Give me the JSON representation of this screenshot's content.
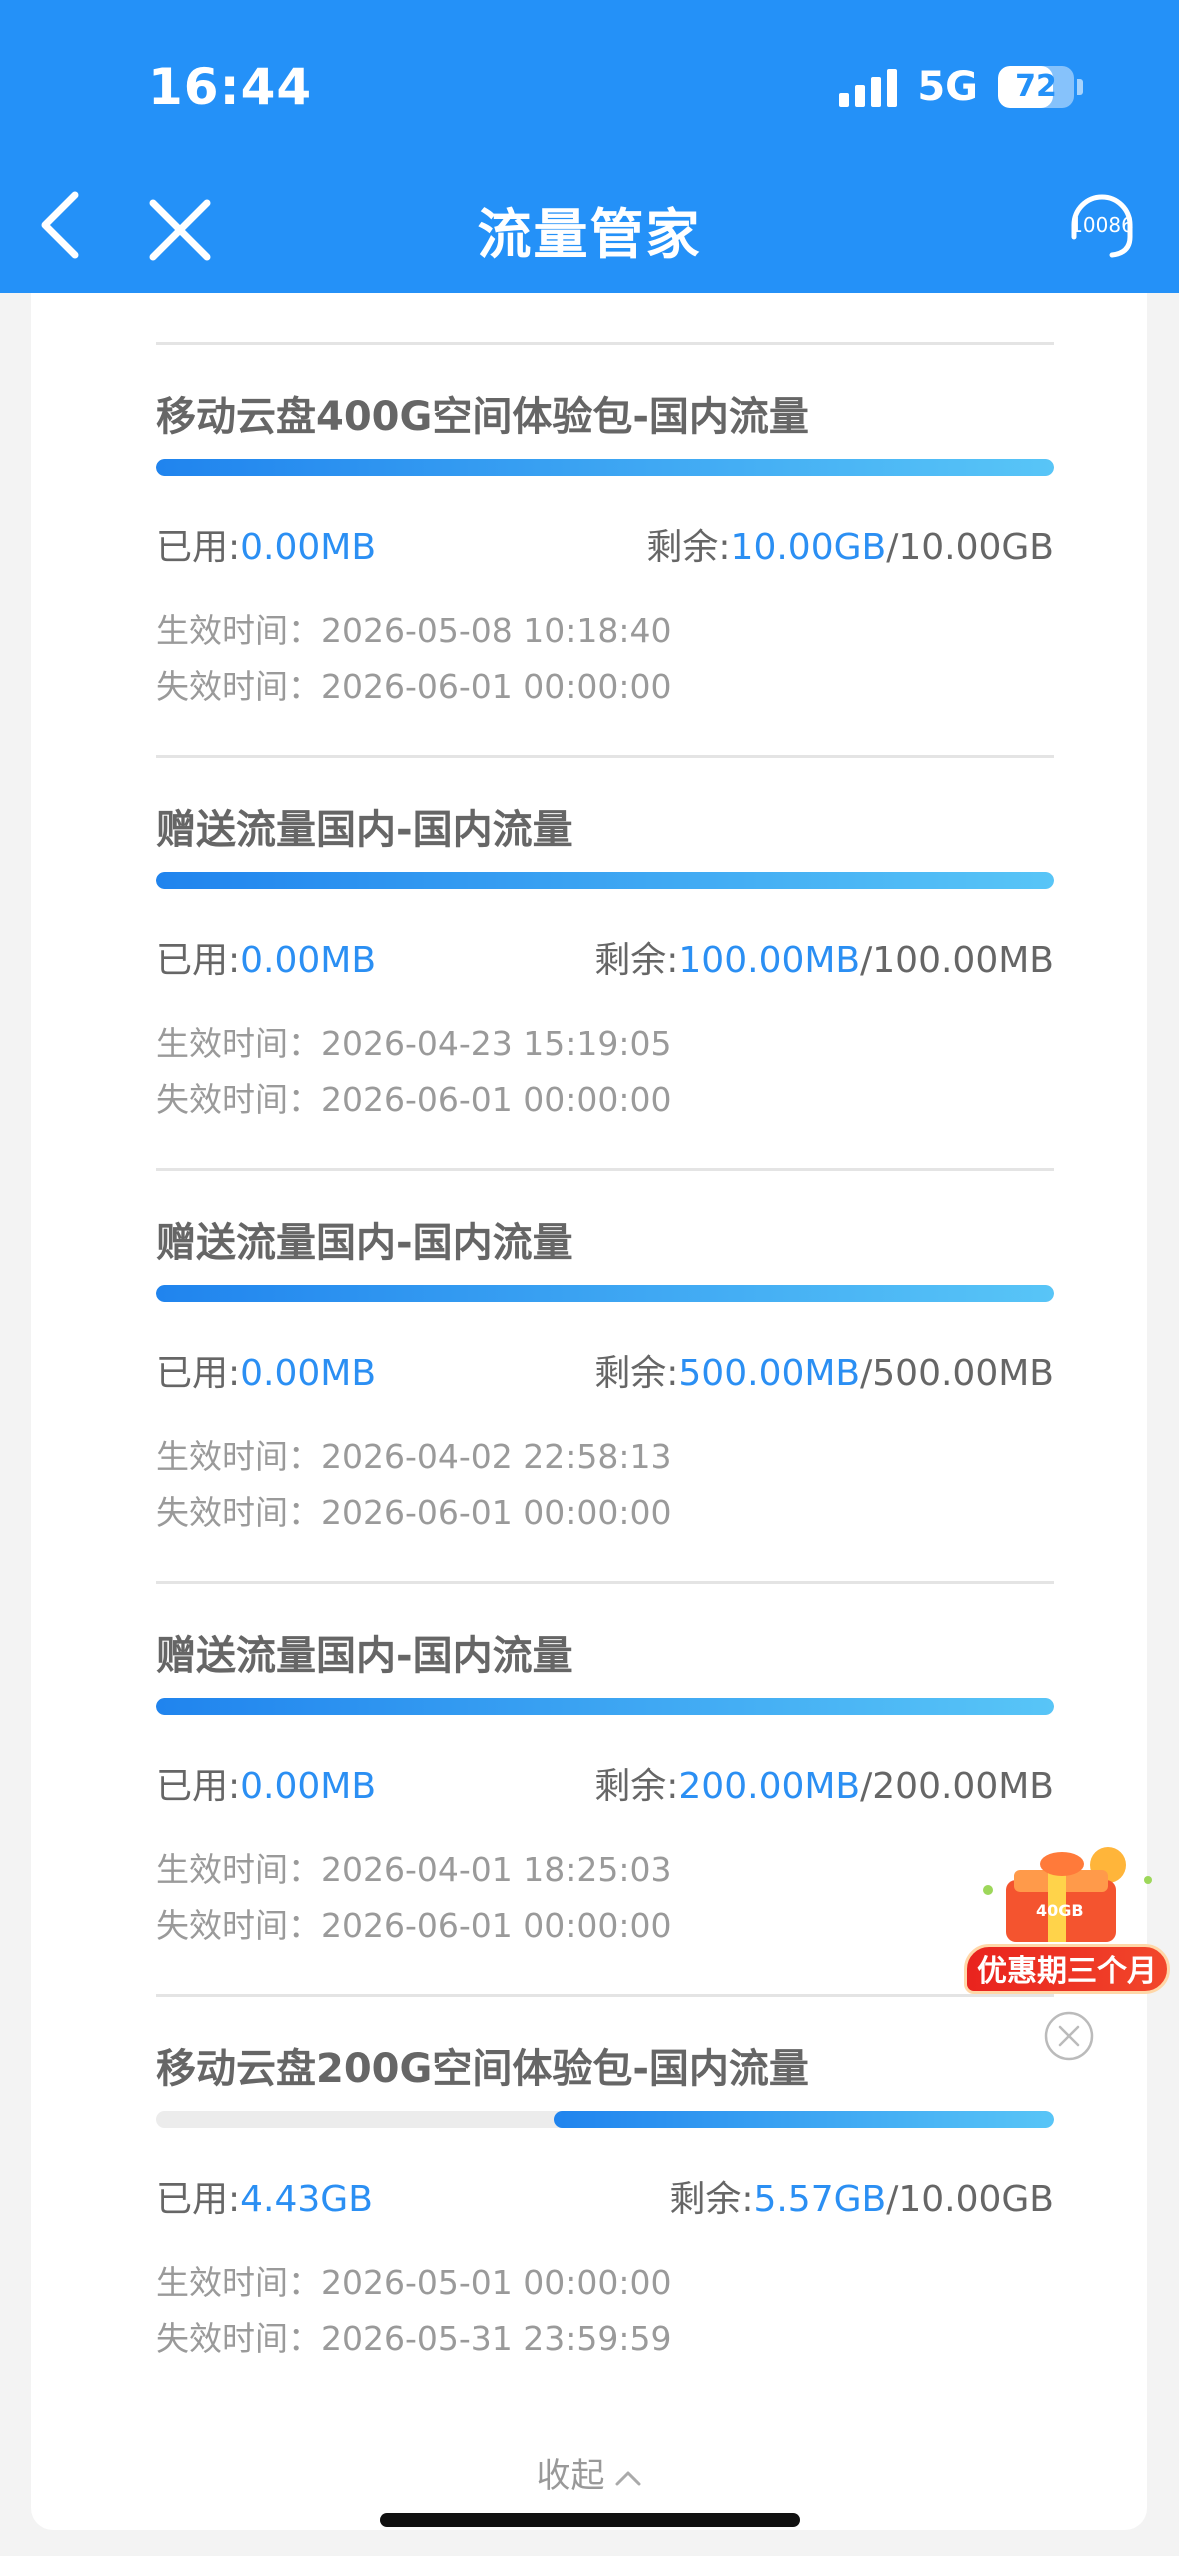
{
  "status_bar": {
    "time": "16:44",
    "network": "5G",
    "battery": "72",
    "battery_level": 0.72
  },
  "nav": {
    "title": "流量管家",
    "service_number": "10086"
  },
  "packages": [
    {
      "name": "移动云盘400G空间体验包-国内流量",
      "used_label": "已用:",
      "used": "0.00MB",
      "remain_label": "剩余:",
      "remain": "10.00GB",
      "total": "/10.00GB",
      "used_fraction": 0.0,
      "effective_label": "生效时间：",
      "effective": "2026-05-08 10:18:40",
      "expire_label": "失效时间：",
      "expire": "2026-06-01 00:00:00"
    },
    {
      "name": "赠送流量国内-国内流量",
      "used_label": "已用:",
      "used": "0.00MB",
      "remain_label": "剩余:",
      "remain": "100.00MB",
      "total": "/100.00MB",
      "used_fraction": 0.0,
      "effective_label": "生效时间：",
      "effective": "2026-04-23 15:19:05",
      "expire_label": "失效时间：",
      "expire": "2026-06-01 00:00:00"
    },
    {
      "name": "赠送流量国内-国内流量",
      "used_label": "已用:",
      "used": "0.00MB",
      "remain_label": "剩余:",
      "remain": "500.00MB",
      "total": "/500.00MB",
      "used_fraction": 0.0,
      "effective_label": "生效时间：",
      "effective": "2026-04-02 22:58:13",
      "expire_label": "失效时间：",
      "expire": "2026-06-01 00:00:00"
    },
    {
      "name": "赠送流量国内-国内流量",
      "used_label": "已用:",
      "used": "0.00MB",
      "remain_label": "剩余:",
      "remain": "200.00MB",
      "total": "/200.00MB",
      "used_fraction": 0.0,
      "effective_label": "生效时间：",
      "effective": "2026-04-01 18:25:03",
      "expire_label": "失效时间：",
      "expire": "2026-06-01 00:00:00"
    },
    {
      "name": "移动云盘200G空间体验包-国内流量",
      "used_label": "已用:",
      "used": "4.43GB",
      "remain_label": "剩余:",
      "remain": "5.57GB",
      "total": "/10.00GB",
      "used_fraction": 0.443,
      "effective_label": "生效时间：",
      "effective": "2026-05-01 00:00:00",
      "expire_label": "失效时间：",
      "expire": "2026-05-31 23:59:59"
    }
  ],
  "collapse_label": "收起",
  "promo": {
    "label": "优惠期三个月",
    "gift_text": "40GB"
  },
  "colors": {
    "primary": "#2491f8",
    "accent_blue": "#2b8ff3",
    "promo_red": "#e9231e"
  }
}
